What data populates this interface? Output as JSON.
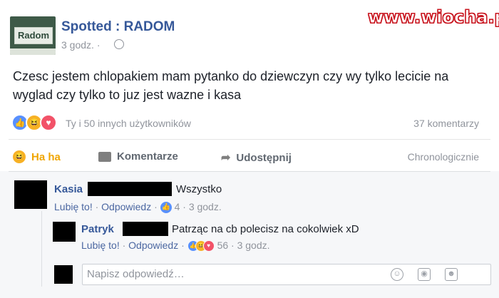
{
  "watermark": "www.wiocha.pl",
  "post": {
    "avatar_text": "Radom",
    "page_name": "Spotted : RADOM",
    "time": "3 godz. ·",
    "text": "Czesc jestem chlopakiem mam pytanko do dziewczyn czy wy tylko lecicie na wyglad czy tylko to juz jest wazne i kasa",
    "reactions_summary": "Ty i 50 innych użytkowników",
    "comments_count": "37 komentarzy",
    "reactions": [
      "like-icon",
      "haha-icon",
      "love-icon"
    ]
  },
  "actions": {
    "haha": "Ha ha",
    "comment": "Komentarze",
    "share": "Udostępnij",
    "sort": "Chronologicznie"
  },
  "comments": [
    {
      "author": "Kasia",
      "text": "Wszystko",
      "like": "Lubię to!",
      "reply": "Odpowiedz",
      "reaction_count": "4",
      "time": "3 godz."
    }
  ],
  "replies": [
    {
      "author": "Patryk",
      "text": "Patrząc na cb polecisz na cokolwiek xD",
      "like": "Lubię to!",
      "reply": "Odpowiedz",
      "reaction_count": "56",
      "time": "3 godz."
    }
  ],
  "reply_input": {
    "placeholder": "Napisz odpowiedź…"
  },
  "colors": {
    "link": "#365899",
    "muted": "#90949c",
    "like": "#5890ff",
    "haha": "#f7b125",
    "love": "#f25268",
    "watermark": "#c8141e"
  }
}
